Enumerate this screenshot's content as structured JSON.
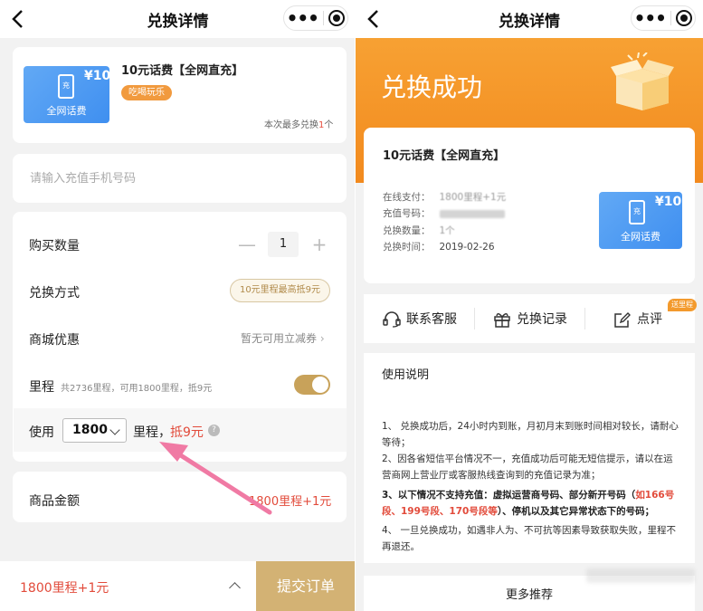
{
  "left": {
    "nav_title": "兑换详情",
    "product": {
      "title": "10元话费【全网直充】",
      "tag": "吃喝玩乐",
      "voucher_amount": "¥10",
      "voucher_caption": "全网话费",
      "voucher_icon_text": "充",
      "limit_prefix": "本次最多兑换",
      "limit_count": "1",
      "limit_suffix": "个"
    },
    "phone_placeholder": "请输入充值手机号码",
    "quantity_label": "购买数量",
    "quantity_value": "1",
    "minus": "—",
    "plus": "+",
    "method_label": "兑换方式",
    "method_pill": "10元里程最高抵9元",
    "discount_label": "商城优惠",
    "discount_value": "暂无可用立减券",
    "mileage_label": "里程",
    "mileage_note": "共2736里程，可用1800里程，抵9元",
    "use_label": "使用",
    "use_value": "1800",
    "use_unit": "里程，",
    "use_offset": "抵9元",
    "help": "?",
    "amount_label": "商品金额",
    "amount_value": "1800里程+1元",
    "bottom_price": "1800里程+1元",
    "submit": "提交订单"
  },
  "right": {
    "nav_title": "兑换详情",
    "success": "兑换成功",
    "product_title": "10元话费【全网直充】",
    "details": [
      {
        "label": "在线支付：",
        "value": "1800里程+1元"
      },
      {
        "label": "充值号码：",
        "value": ""
      },
      {
        "label": "兑换数量：",
        "value": "1个"
      },
      {
        "label": "兑换时间：",
        "value": "2019-02-26"
      }
    ],
    "voucher_amount": "¥10",
    "voucher_caption": "全网话费",
    "voucher_icon_text": "充",
    "actions": [
      "联系客服",
      "兑换记录",
      "点评"
    ],
    "badge": "送里程",
    "usage_title": "使用说明",
    "usage": {
      "p1": "1、 兑换成功后，24小时内到账，月初月末到账时间相对较长，请耐心等待；",
      "p2": "2、因各省短信平台情况不一，充值成功后可能无短信提示，请以在运营商网上营业厅或客服热线查询到的充值记录为准；",
      "p3a": "3、以下情况不支持充值：虚拟运营商号码、部分新开号码（",
      "p3red": "如166号段、199号段、170号段等",
      "p3b": "）、停机以及其它异常状态下的号码；",
      "p4": "4、 一旦兑换成功，如遇非人为、不可抗等因素导致获取失败，里程不再退还。"
    },
    "more": "更多推荐"
  },
  "colors": {
    "accent_orange": "#f28a1e",
    "price_red": "#e24b3b",
    "gold": "#d3b274",
    "voucher_blue": "#4a97f2"
  }
}
